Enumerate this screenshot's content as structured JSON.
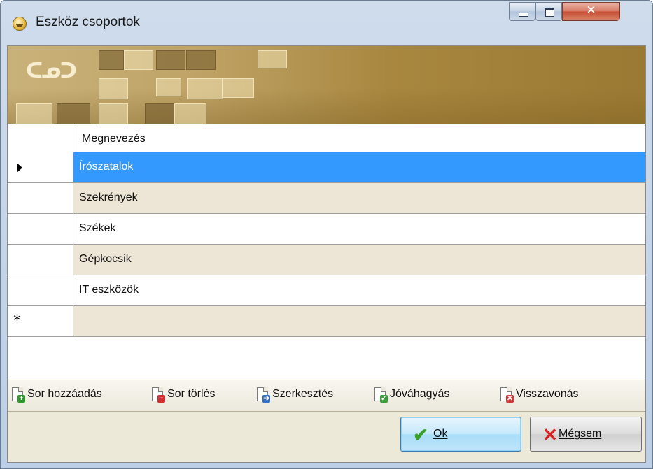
{
  "window": {
    "title": "Eszköz csoportok"
  },
  "grid": {
    "column_header": "Megnevezés",
    "rows": [
      "Írószatalok",
      "Szekrények",
      "Székek",
      "Gépkocsik",
      "IT eszközök"
    ],
    "selected_index": 0,
    "new_row_marker": "*"
  },
  "toolbar": {
    "add_row": "Sor hozzáadás",
    "delete_row": "Sor törlés",
    "edit": "Szerkesztés",
    "approve": "Jóváhagyás",
    "revert": "Visszavonás"
  },
  "buttons": {
    "ok": "Ok",
    "cancel": "Mégsem"
  },
  "icons": {
    "app": "app-icon",
    "add_row": "document-add-icon",
    "delete_row": "document-delete-icon",
    "edit": "document-edit-icon",
    "approve": "document-approve-icon",
    "revert": "document-revert-icon",
    "ok": "checkmark-icon",
    "cancel": "x-icon"
  },
  "colors": {
    "selection": "#3399ff",
    "alt_row": "#ede6d6",
    "banner": "#b89a55"
  }
}
